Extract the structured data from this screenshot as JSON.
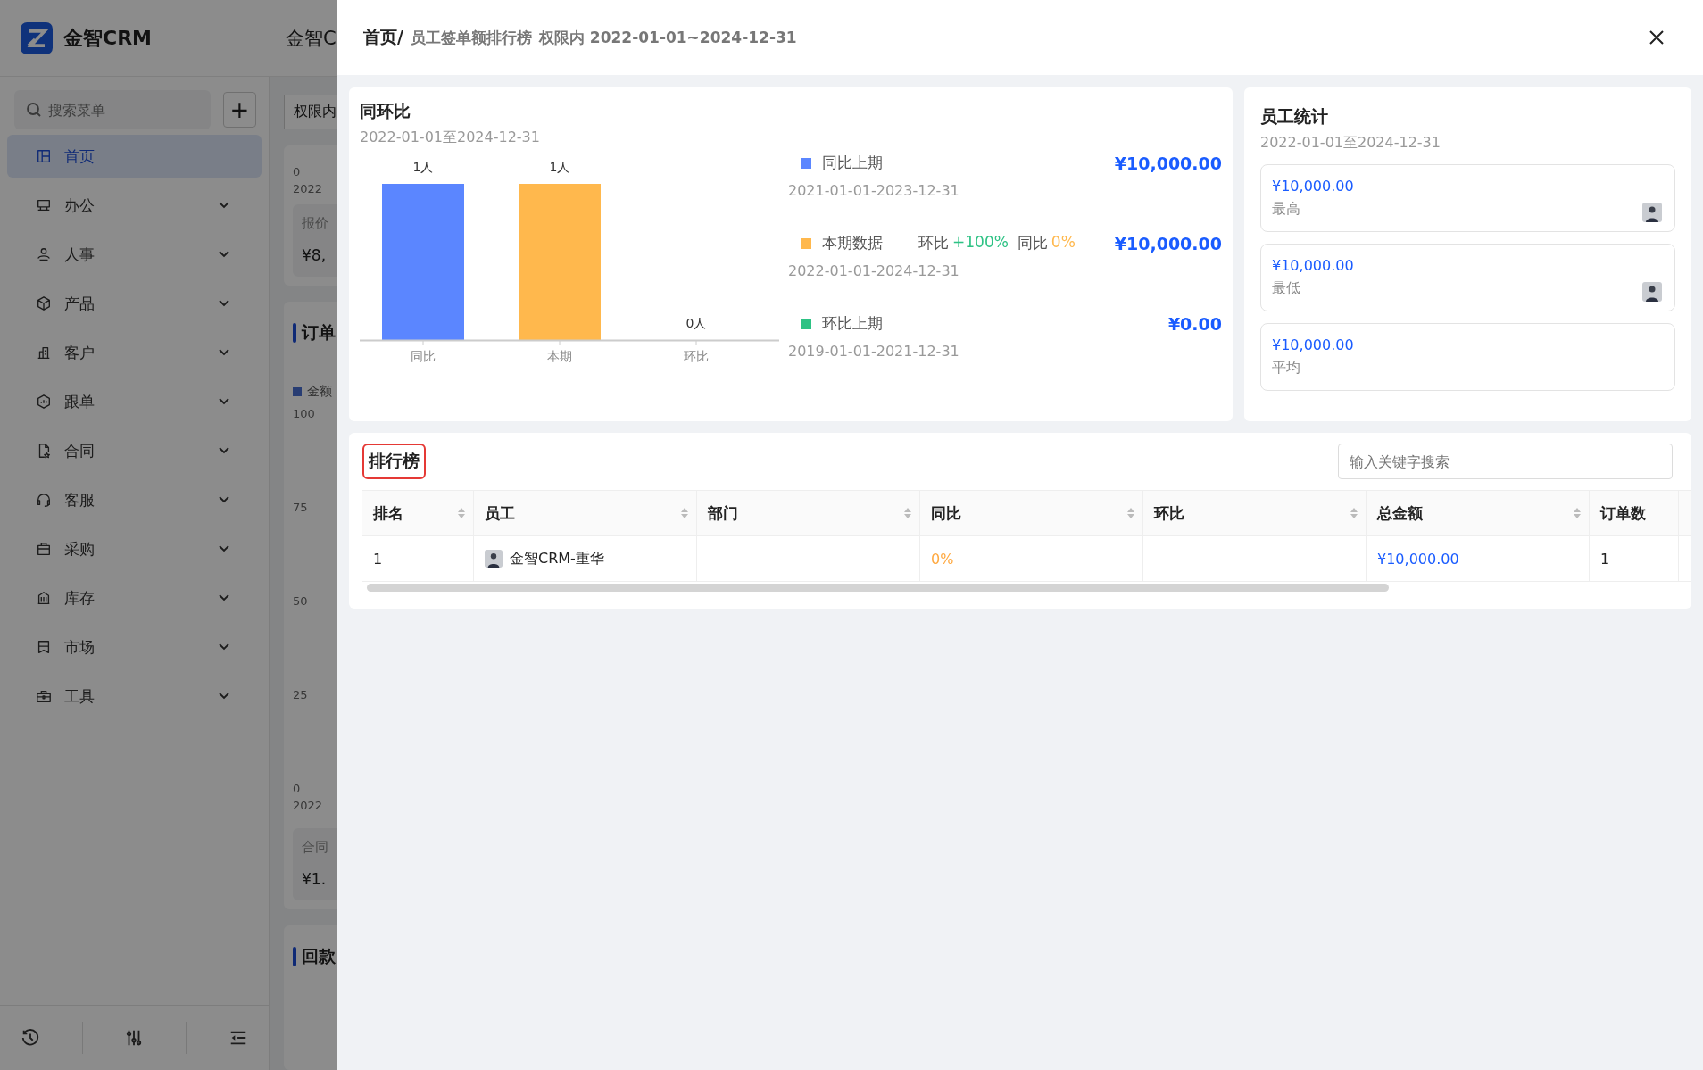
{
  "app": {
    "brand": "金智CRM",
    "title_fragment": "金智C"
  },
  "sidebar": {
    "search": {
      "placeholder": "搜索菜单"
    },
    "add_button": "+",
    "items": [
      {
        "label": "首页",
        "selected": true,
        "expandable": false
      },
      {
        "label": "办公",
        "selected": false,
        "expandable": true
      },
      {
        "label": "人事",
        "selected": false,
        "expandable": true
      },
      {
        "label": "产品",
        "selected": false,
        "expandable": true
      },
      {
        "label": "客户",
        "selected": false,
        "expandable": true
      },
      {
        "label": "跟单",
        "selected": false,
        "expandable": true
      },
      {
        "label": "合同",
        "selected": false,
        "expandable": true
      },
      {
        "label": "客服",
        "selected": false,
        "expandable": true
      },
      {
        "label": "采购",
        "selected": false,
        "expandable": true
      },
      {
        "label": "库存",
        "selected": false,
        "expandable": true
      },
      {
        "label": "市场",
        "selected": false,
        "expandable": true
      },
      {
        "label": "工具",
        "selected": false,
        "expandable": true
      }
    ]
  },
  "background": {
    "filter_fragment": "权限内",
    "summary_card": {
      "axis_value": "0",
      "axis_date": "2022",
      "label": "报价",
      "value": "¥8,"
    },
    "order_card": {
      "title": "订单",
      "legend": "金额",
      "yticks": [
        "100",
        "75",
        "50",
        "25",
        "0"
      ],
      "axis_date": "2022",
      "label": "合同",
      "value": "¥1."
    },
    "payment_card": {
      "title": "回款"
    }
  },
  "drawer": {
    "breadcrumb": {
      "home": "首页/",
      "page": "员工签单额排行榜",
      "scope": "权限内 2022-01-01~2024-12-31"
    },
    "comparison": {
      "title": "同环比",
      "period": "2022-01-01至2024-12-31",
      "chart_data": {
        "type": "bar",
        "categories": [
          "同比",
          "本期",
          "环比"
        ],
        "values": [
          1,
          1,
          0
        ],
        "value_labels": [
          "1人",
          "1人",
          "0人"
        ]
      },
      "legend": [
        {
          "label": "同比上期",
          "color": "#5b86ff",
          "period": "2021-01-01-2023-12-31",
          "amount": "¥10,000.00"
        },
        {
          "label": "本期数据",
          "color": "#ffb84d",
          "period": "2022-01-01-2024-12-31",
          "amount": "¥10,000.00",
          "changes": [
            {
              "label": "环比",
              "value": "+100%",
              "color": "#2dc284"
            },
            {
              "label": "同比",
              "value": "0%",
              "color": "#ffb84d"
            }
          ]
        },
        {
          "label": "环比上期",
          "color": "#2dc284",
          "period": "2019-01-01-2021-12-31",
          "amount": "¥0.00"
        }
      ]
    },
    "staff_stats": {
      "title": "员工统计",
      "period": "2022-01-01至2024-12-31",
      "cards": [
        {
          "amount": "¥10,000.00",
          "label": "最高",
          "avatar": true
        },
        {
          "amount": "¥10,000.00",
          "label": "最低",
          "avatar": true
        },
        {
          "amount": "¥10,000.00",
          "label": "平均",
          "avatar": false
        }
      ]
    },
    "ranking": {
      "title": "排行榜",
      "highlighted": true,
      "search": {
        "placeholder": "输入关键字搜索"
      },
      "columns": [
        {
          "label": "排名",
          "sortable": true
        },
        {
          "label": "员工",
          "sortable": true
        },
        {
          "label": "部门",
          "sortable": true
        },
        {
          "label": "同比",
          "sortable": true
        },
        {
          "label": "环比",
          "sortable": true
        },
        {
          "label": "总金额",
          "sortable": true
        },
        {
          "label": "订单数",
          "sortable": false
        }
      ],
      "rows": [
        {
          "rank": "1",
          "employee": "金智CRM-重华",
          "avatar": true,
          "yoy": "0%",
          "total": "¥10,000.00",
          "orders": "1"
        }
      ]
    }
  }
}
